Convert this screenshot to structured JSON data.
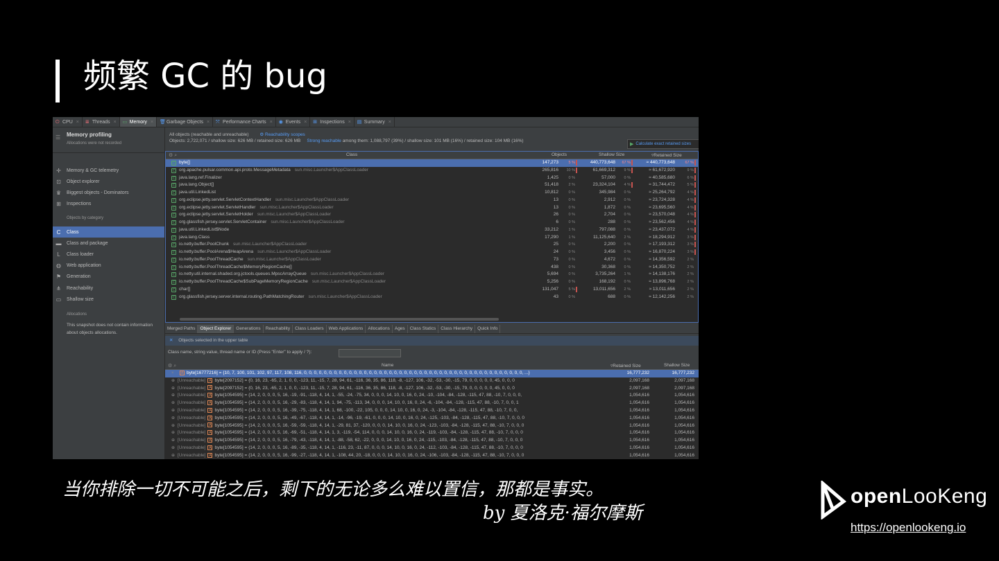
{
  "slide": {
    "title": "频繁 GC 的 bug",
    "quote": "当你排除一切不可能之后，剩下的无论多么难以置信，那都是事实。",
    "quote_by": "by 夏洛克·福尔摩斯",
    "logo_text_bold": "open",
    "logo_text_rest": "LooKeng",
    "url": "https://openlookeng.io"
  },
  "tabs": [
    {
      "label": "CPU",
      "icon": "cpu-icon"
    },
    {
      "label": "Threads",
      "icon": "threads-icon"
    },
    {
      "label": "Memory",
      "icon": "memory-icon",
      "active": true
    },
    {
      "label": "Garbage Objects",
      "icon": "trash-icon"
    },
    {
      "label": "Performance Charts",
      "icon": "chart-icon"
    },
    {
      "label": "Events",
      "icon": "eye-icon"
    },
    {
      "label": "Inspections",
      "icon": "inspections-icon"
    },
    {
      "label": "Summary",
      "icon": "summary-icon"
    }
  ],
  "sidebar": {
    "title": "Memory profiling",
    "subtitle": "Allocations were not recorded",
    "items": [
      {
        "label": "Memory & GC telemetry",
        "icon": "telemetry-icon"
      },
      {
        "label": "Object explorer",
        "icon": "object-explorer-icon"
      },
      {
        "label": "Biggest objects - Dominators",
        "icon": "crown-icon"
      },
      {
        "label": "Inspections",
        "icon": "inspections-icon"
      }
    ],
    "section_objects": "Objects by category",
    "category_items": [
      {
        "label": "Class",
        "icon": "class-icon",
        "active": true
      },
      {
        "label": "Class and package",
        "icon": "package-icon"
      },
      {
        "label": "Class loader",
        "icon": "class-loader-icon"
      },
      {
        "label": "Web application",
        "icon": "globe-icon"
      },
      {
        "label": "Generation",
        "icon": "flag-icon"
      },
      {
        "label": "Reachability",
        "icon": "reachability-icon"
      },
      {
        "label": "Shallow size",
        "icon": "shallow-size-icon"
      }
    ],
    "section_allocations": "Allocations",
    "allocations_note": "This snapshot does not contain information about objects allocations."
  },
  "info": {
    "line1": "All objects (reachable and unreachable)",
    "reachability_link": "Reachability scopes",
    "line2": "Objects: 2,722,071 / shallow size: 626 MB / retained size: 626 MB",
    "strong_reachable_link": "Strong reachable",
    "line2b": "among them: 1,088,797 (39%) / shallow size: 101 MB (16%) / retained size: 104 MB (16%)",
    "calc_button": "Calculate exact retained sizes"
  },
  "upper_table": {
    "columns": {
      "class": "Class",
      "objects": "Objects",
      "shallow": "Shallow Size",
      "retained": "Retained Size"
    },
    "rows": [
      {
        "name": "byte[]",
        "loader": "",
        "objects": "147,273",
        "op": "5 %",
        "shallow": "440,773,648",
        "sp": "67 %",
        "retained": "≈ 440,773,648",
        "rp": "67 %"
      },
      {
        "name": "org.apache.pulsar.common.api.proto.MessageMetadata",
        "loader": "sun.misc.Launcher$AppClassLoader",
        "objects": "265,816",
        "op": "10 %",
        "shallow": "61,669,312",
        "sp": "9 %",
        "retained": "≈ 61,672,920",
        "rp": "9 %"
      },
      {
        "name": "java.lang.ref.Finalizer",
        "loader": "",
        "objects": "1,425",
        "op": "0 %",
        "shallow": "57,000",
        "sp": "0 %",
        "retained": "≈ 40,585,680",
        "rp": "6 %"
      },
      {
        "name": "java.lang.Object[]",
        "loader": "",
        "objects": "51,418",
        "op": "2 %",
        "shallow": "23,324,104",
        "sp": "4 %",
        "retained": "≈ 31,744,472",
        "rp": "5 %"
      },
      {
        "name": "java.util.LinkedList",
        "loader": "",
        "objects": "10,812",
        "op": "0 %",
        "shallow": "345,984",
        "sp": "0 %",
        "retained": "≈ 25,264,792",
        "rp": "4 %"
      },
      {
        "name": "org.eclipse.jetty.servlet.ServletContextHandler",
        "loader": "sun.misc.Launcher$AppClassLoader",
        "objects": "13",
        "op": "0 %",
        "shallow": "2,912",
        "sp": "0 %",
        "retained": "≈ 23,724,328",
        "rp": "4 %"
      },
      {
        "name": "org.eclipse.jetty.servlet.ServletHandler",
        "loader": "sun.misc.Launcher$AppClassLoader",
        "objects": "13",
        "op": "0 %",
        "shallow": "1,872",
        "sp": "0 %",
        "retained": "≈ 23,695,560",
        "rp": "4 %"
      },
      {
        "name": "org.eclipse.jetty.servlet.ServletHolder",
        "loader": "sun.misc.Launcher$AppClassLoader",
        "objects": "26",
        "op": "0 %",
        "shallow": "2,704",
        "sp": "0 %",
        "retained": "≈ 23,570,048",
        "rp": "4 %"
      },
      {
        "name": "org.glassfish.jersey.servlet.ServletContainer",
        "loader": "sun.misc.Launcher$AppClassLoader",
        "objects": "6",
        "op": "0 %",
        "shallow": "288",
        "sp": "0 %",
        "retained": "≈ 23,562,456",
        "rp": "4 %"
      },
      {
        "name": "java.util.LinkedList$Node",
        "loader": "",
        "objects": "33,212",
        "op": "1 %",
        "shallow": "797,088",
        "sp": "0 %",
        "retained": "≈ 23,437,072",
        "rp": "4 %"
      },
      {
        "name": "java.lang.Class",
        "loader": "",
        "objects": "17,290",
        "op": "1 %",
        "shallow": "11,125,640",
        "sp": "2 %",
        "retained": "≈ 18,294,912",
        "rp": "3 %"
      },
      {
        "name": "io.netty.buffer.PoolChunk",
        "loader": "sun.misc.Launcher$AppClassLoader",
        "objects": "25",
        "op": "0 %",
        "shallow": "2,200",
        "sp": "0 %",
        "retained": "≈ 17,193,312",
        "rp": "3 %"
      },
      {
        "name": "io.netty.buffer.PoolArena$HeapArena",
        "loader": "sun.misc.Launcher$AppClassLoader",
        "objects": "24",
        "op": "0 %",
        "shallow": "3,456",
        "sp": "0 %",
        "retained": "≈ 16,870,224",
        "rp": "3 %"
      },
      {
        "name": "io.netty.buffer.PoolThreadCache",
        "loader": "sun.misc.Launcher$AppClassLoader",
        "objects": "73",
        "op": "0 %",
        "shallow": "4,672",
        "sp": "0 %",
        "retained": "≈ 14,356,592",
        "rp": "2 %"
      },
      {
        "name": "io.netty.buffer.PoolThreadCache$MemoryRegionCache[]",
        "loader": "",
        "objects": "438",
        "op": "0 %",
        "shallow": "30,368",
        "sp": "0 %",
        "retained": "≈ 14,350,752",
        "rp": "2 %"
      },
      {
        "name": "io.netty.util.internal.shaded.org.jctools.queues.MpscArrayQueue",
        "loader": "sun.misc.Launcher$AppClassLoader",
        "objects": "5,694",
        "op": "0 %",
        "shallow": "3,735,264",
        "sp": "1 %",
        "retained": "≈ 14,138,176",
        "rp": "2 %"
      },
      {
        "name": "io.netty.buffer.PoolThreadCache$SubPageMemoryRegionCache",
        "loader": "sun.misc.Launcher$AppClassLoader",
        "objects": "5,256",
        "op": "0 %",
        "shallow": "168,192",
        "sp": "0 %",
        "retained": "≈ 13,896,768",
        "rp": "2 %"
      },
      {
        "name": "char[]",
        "loader": "",
        "objects": "131,047",
        "op": "5 %",
        "shallow": "13,011,656",
        "sp": "2 %",
        "retained": "≈ 13,011,656",
        "rp": "2 %"
      },
      {
        "name": "org.glassfish.jersey.server.internal.routing.PathMatchingRouter",
        "loader": "sun.misc.Launcher$AppClassLoader",
        "objects": "43",
        "op": "0 %",
        "shallow": "688",
        "sp": "0 %",
        "retained": "≈ 12,142,256",
        "rp": "2 %"
      }
    ]
  },
  "lower_tabs": [
    "Merged Paths",
    "Object Explorer",
    "Generations",
    "Reachability",
    "Class Loaders",
    "Web Applications",
    "Allocations",
    "Ages",
    "Class Statics",
    "Class Hierarchy",
    "Quick Info"
  ],
  "lower_tab_active": "Object Explorer",
  "objects_selected": "Objects selected in the upper table",
  "filter_label": "Class name, string value, thread name or ID  (Press \"Enter\" to apply / ?):",
  "lower_table": {
    "columns": {
      "name": "Name",
      "retained": "Retained Size",
      "shallow": "Shallow Size"
    },
    "rows": [
      {
        "prefix": "",
        "name": "byte[16777216] = {10, 7, 100, 101, 102, 97, 117, 108, 116, 0, 0, 0, 0, 0, 0, 0, 0, 0, 0, 0, 0, 0, 0, 0, 0, 0, 0, 0, 0, 0, 0, 0, 0, 0, 0, 0, 0, 0, 0, 0, 0, 0, 0, 0, 0, 0, 0, 0, 0, 0, 0, 0, 0, ...}",
        "retained": "16,777,232",
        "shallow": "16,777,232"
      },
      {
        "prefix": "[Unreachable]",
        "name": "byte[2097152] = {0, 16, 23, -65, 2, 1, 0, 0, -123, 11, -15, 7, 28, 94, 61, -116, 36, 35, 86, 118, -8, -127, 106, -32, -53, -30, -15, 79, 0, 0, 0, 0, 0, 45, 0, 0, 0",
        "retained": "2,097,168",
        "shallow": "2,097,168"
      },
      {
        "prefix": "[Unreachable]",
        "name": "byte[2097152] = {0, 16, 23, -65, 2, 1, 0, 0, -123, 11, -15, 7, 28, 94, 61, -116, 36, 35, 86, 118, -8, -127, 106, -32, -53, -30, -15, 79, 0, 0, 0, 0, 0, 45, 0, 0, 0",
        "retained": "2,097,168",
        "shallow": "2,097,168"
      },
      {
        "prefix": "[Unreachable]",
        "name": "byte[1054595] = {14, 2, 0, 0, 0, 5, 16, -19, -91, -118, 4, 14, 1, -55, -24, -75, 34, 0, 0, 0, 14, 10, 0, 16, 0, 24, -10, -104, -84, -128, -115, 47, 88, -10, 7, 0, 0, 0,",
        "retained": "1,054,616",
        "shallow": "1,054,616"
      },
      {
        "prefix": "[Unreachable]",
        "name": "byte[1054595] = {14, 2, 0, 0, 0, 5, 16, -29, -83, -118, 4, 14, 1, 94, -75, -113, 34, 0, 0, 0, 14, 10, 0, 16, 0, 24, -6, -104, -84, -128, -115, 47, 88, -10, 7, 0, 0, 1",
        "retained": "1,054,616",
        "shallow": "1,054,616"
      },
      {
        "prefix": "[Unreachable]",
        "name": "byte[1054595] = {14, 2, 0, 0, 0, 5, 16, -39, -75, -118, 4, 14, 1, 68, -100, -22, 105, 0, 0, 0, 14, 10, 0, 16, 0, 24, -3, -104, -84, -128, -115, 47, 88, -10, 7, 0, 0,",
        "retained": "1,054,616",
        "shallow": "1,054,616"
      },
      {
        "prefix": "[Unreachable]",
        "name": "byte[1054595] = {14, 2, 0, 0, 0, 5, 16, -49, -67, -118, 4, 14, 1, -14, -96, -19, -61, 0, 0, 0, 14, 10, 0, 16, 0, 24, -125, -103, -84, -128, -115, 47, 88, -10, 7, 0, 0, 0",
        "retained": "1,054,616",
        "shallow": "1,054,616"
      },
      {
        "prefix": "[Unreachable]",
        "name": "byte[1054595] = {14, 2, 0, 0, 0, 5, 16, -59, -59, -118, 4, 14, 1, -29, 81, 37, -120, 0, 0, 0, 14, 10, 0, 16, 0, 24, -123, -103, -84, -128, -115, 47, 88, -10, 7, 0, 0, 0",
        "retained": "1,054,616",
        "shallow": "1,054,616"
      },
      {
        "prefix": "[Unreachable]",
        "name": "byte[1054595] = {14, 2, 0, 0, 0, 5, 16, -69, -51, -118, 4, 14, 1, 3, -119, -54, 114, 0, 0, 0, 14, 10, 0, 16, 0, 24, -119, -103, -84, -128, -115, 47, 88, -10, 7, 0, 0, 0",
        "retained": "1,054,616",
        "shallow": "1,054,616"
      },
      {
        "prefix": "[Unreachable]",
        "name": "byte[1054595] = {14, 2, 0, 0, 0, 5, 16, -79, -43, -118, 4, 14, 1, -88, -58, 62, -22, 0, 0, 0, 14, 10, 0, 16, 0, 24, -115, -103, -84, -128, -115, 47, 88, -10, 7, 0, 0, 0",
        "retained": "1,054,616",
        "shallow": "1,054,616"
      },
      {
        "prefix": "[Unreachable]",
        "name": "byte[1054595] = {14, 2, 0, 0, 0, 5, 16, -89, -35, -118, 4, 14, 1, -116, 23, -11, 87, 0, 0, 0, 14, 10, 0, 16, 0, 24, -112, -103, -84, -128, -115, 47, 88, -10, 7, 0, 0, 0",
        "retained": "1,054,616",
        "shallow": "1,054,616"
      },
      {
        "prefix": "[Unreachable]",
        "name": "byte[1054595] = {14, 2, 0, 0, 0, 5, 16, -99, -27, -118, 4, 14, 1, -108, 44, 20, -18, 0, 0, 0, 14, 10, 0, 16, 0, 24, -106, -103, -84, -128, -115, 47, 88, -10, 7, 0, 0, 0",
        "retained": "1,054,616",
        "shallow": "1,054,616"
      },
      {
        "prefix": "[Unreachable]",
        "name": "byte[1054595] = {14, 2, 0, 0, 0, 5, 16, -109, -19, -118, 4, 14, 1, -111, -49, -4, 82, 0, 0, 0, 14, 10, 0, 16, 0, 24, -104, -103, -84, -128, -115, 47, 88, -10, 7, 0, 0,",
        "retained": "1,054,616",
        "shallow": "1,054,616"
      }
    ]
  }
}
